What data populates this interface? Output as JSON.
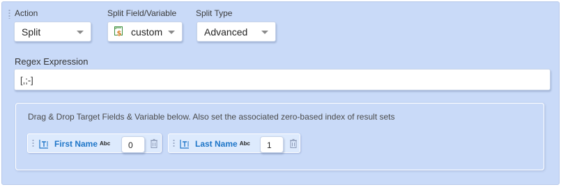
{
  "labels": {
    "action": "Action",
    "split_field": "Split Field/Variable",
    "split_type": "Split Type",
    "regex": "Regex Expression"
  },
  "action_select": {
    "value": "Split"
  },
  "split_field_select": {
    "value": "custom",
    "icon": "dollar-variable-icon"
  },
  "split_type_select": {
    "value": "Advanced"
  },
  "regex_input": {
    "value": "[,;-]"
  },
  "targets": {
    "description": "Drag & Drop Target Fields & Variable below. Also set the associated zero-based index of result sets",
    "fields": [
      {
        "name": "First Name",
        "type_badge": "Abc",
        "index": "0",
        "icon": "text-field-icon"
      },
      {
        "name": "Last Name",
        "type_badge": "Abc",
        "index": "1",
        "icon": "text-field-icon"
      }
    ]
  },
  "colors": {
    "panel_bg": "#c9daf8",
    "field_name": "#1f76c8",
    "chip_bg": "#ddeafd"
  }
}
